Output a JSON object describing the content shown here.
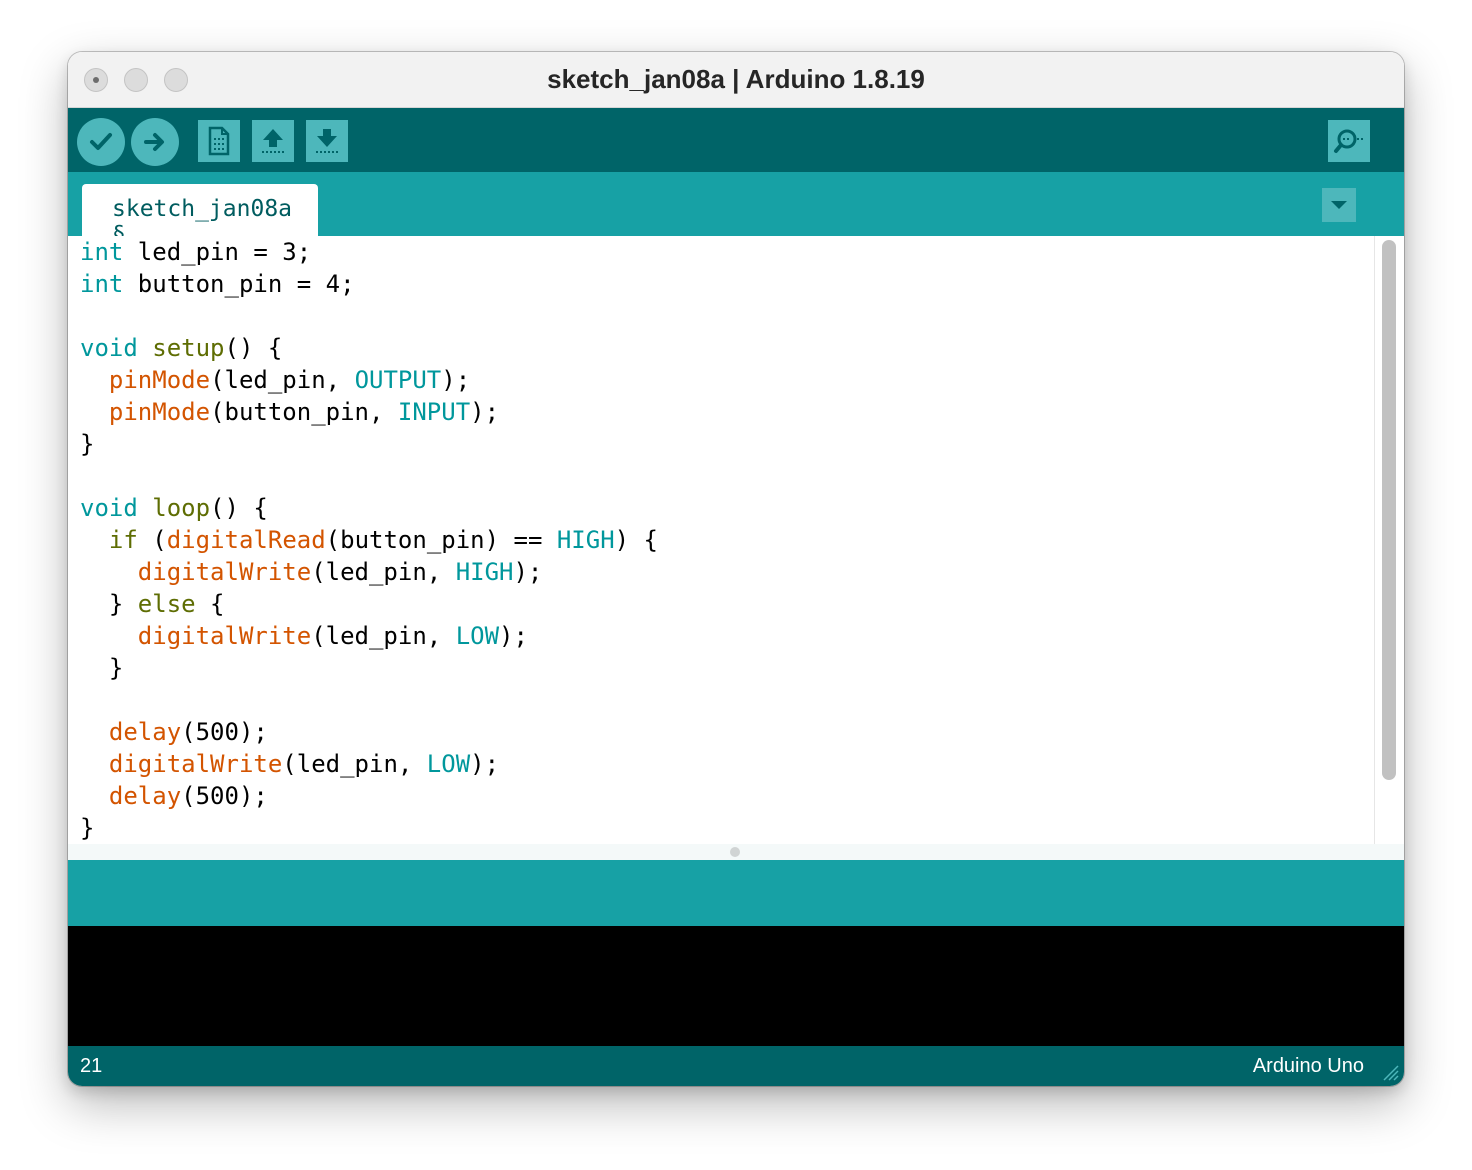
{
  "window": {
    "title": "sketch_jan08a | Arduino 1.8.19"
  },
  "toolbar": {
    "verify": "verify-icon",
    "upload": "upload-arrow-icon",
    "new": "new-file-icon",
    "open": "open-icon",
    "save": "save-icon",
    "serial_monitor": "serial-monitor-icon",
    "colors": {
      "toolbar_bg": "#006468",
      "button_bg": "#4db7bb",
      "tabbar_bg": "#17a1a5"
    }
  },
  "tabs": [
    {
      "label": "sketch_jan08a §"
    }
  ],
  "editor": {
    "syntax_colors": {
      "type": "#00979c",
      "keyword": "#5e6d03",
      "function": "#d35400",
      "constant": "#00979c"
    },
    "lines": [
      [
        {
          "t": "int",
          "c": "type"
        },
        {
          "t": " led_pin = 3;",
          "c": "plain"
        }
      ],
      [
        {
          "t": "int",
          "c": "type"
        },
        {
          "t": " button_pin = 4;",
          "c": "plain"
        }
      ],
      [],
      [
        {
          "t": "void",
          "c": "type"
        },
        {
          "t": " ",
          "c": "plain"
        },
        {
          "t": "setup",
          "c": "kw"
        },
        {
          "t": "() {",
          "c": "plain"
        }
      ],
      [
        {
          "t": "  ",
          "c": "plain"
        },
        {
          "t": "pinMode",
          "c": "fn"
        },
        {
          "t": "(led_pin, ",
          "c": "plain"
        },
        {
          "t": "OUTPUT",
          "c": "const"
        },
        {
          "t": ");",
          "c": "plain"
        }
      ],
      [
        {
          "t": "  ",
          "c": "plain"
        },
        {
          "t": "pinMode",
          "c": "fn"
        },
        {
          "t": "(button_pin, ",
          "c": "plain"
        },
        {
          "t": "INPUT",
          "c": "const"
        },
        {
          "t": ");",
          "c": "plain"
        }
      ],
      [
        {
          "t": "}",
          "c": "plain"
        }
      ],
      [],
      [
        {
          "t": "void",
          "c": "type"
        },
        {
          "t": " ",
          "c": "plain"
        },
        {
          "t": "loop",
          "c": "kw"
        },
        {
          "t": "() {",
          "c": "plain"
        }
      ],
      [
        {
          "t": "  ",
          "c": "plain"
        },
        {
          "t": "if",
          "c": "kw"
        },
        {
          "t": " (",
          "c": "plain"
        },
        {
          "t": "digitalRead",
          "c": "fn"
        },
        {
          "t": "(button_pin) == ",
          "c": "plain"
        },
        {
          "t": "HIGH",
          "c": "const"
        },
        {
          "t": ") {",
          "c": "plain"
        }
      ],
      [
        {
          "t": "    ",
          "c": "plain"
        },
        {
          "t": "digitalWrite",
          "c": "fn"
        },
        {
          "t": "(led_pin, ",
          "c": "plain"
        },
        {
          "t": "HIGH",
          "c": "const"
        },
        {
          "t": ");",
          "c": "plain"
        }
      ],
      [
        {
          "t": "  } ",
          "c": "plain"
        },
        {
          "t": "else",
          "c": "kw"
        },
        {
          "t": " {",
          "c": "plain"
        }
      ],
      [
        {
          "t": "    ",
          "c": "plain"
        },
        {
          "t": "digitalWrite",
          "c": "fn"
        },
        {
          "t": "(led_pin, ",
          "c": "plain"
        },
        {
          "t": "LOW",
          "c": "const"
        },
        {
          "t": ");",
          "c": "plain"
        }
      ],
      [
        {
          "t": "  }",
          "c": "plain"
        }
      ],
      [],
      [
        {
          "t": "  ",
          "c": "plain"
        },
        {
          "t": "delay",
          "c": "fn"
        },
        {
          "t": "(500);",
          "c": "plain"
        }
      ],
      [
        {
          "t": "  ",
          "c": "plain"
        },
        {
          "t": "digitalWrite",
          "c": "fn"
        },
        {
          "t": "(led_pin, ",
          "c": "plain"
        },
        {
          "t": "LOW",
          "c": "const"
        },
        {
          "t": ");",
          "c": "plain"
        }
      ],
      [
        {
          "t": "  ",
          "c": "plain"
        },
        {
          "t": "delay",
          "c": "fn"
        },
        {
          "t": "(500);",
          "c": "plain"
        }
      ],
      [
        {
          "t": "}",
          "c": "plain"
        }
      ]
    ]
  },
  "footer": {
    "line_number": "21",
    "board": "Arduino Uno"
  }
}
